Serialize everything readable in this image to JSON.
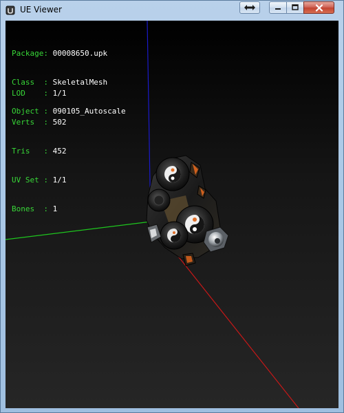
{
  "window": {
    "title": "UE Viewer"
  },
  "titlebar_buttons": {
    "swap_icon": "double-arrow-icon",
    "minimize_icon": "minimize-icon",
    "maximize_icon": "maximize-icon",
    "close_icon": "close-icon"
  },
  "info_object": [
    {
      "key": "Package:",
      "value": "00008650.upk"
    },
    {
      "key": "Class  :",
      "value": "SkeletalMesh"
    },
    {
      "key": "Object :",
      "value": "090105_Autoscale"
    }
  ],
  "info_mesh": [
    {
      "key": "LOD    :",
      "value": "1/1"
    },
    {
      "key": "Verts  :",
      "value": "502"
    },
    {
      "key": "Tris   :",
      "value": "452"
    },
    {
      "key": "UV Set :",
      "value": "1/1"
    },
    {
      "key": "Bones  :",
      "value": "1"
    }
  ],
  "colors": {
    "label": "#38d838",
    "value": "#ffffff",
    "axis_x": "#c81818",
    "axis_y": "#1ec81e",
    "axis_z": "#1a1acc"
  },
  "scene": {
    "axes": [
      "x-axis",
      "y-axis",
      "z-axis"
    ],
    "model": "skeletal-mesh-render"
  }
}
